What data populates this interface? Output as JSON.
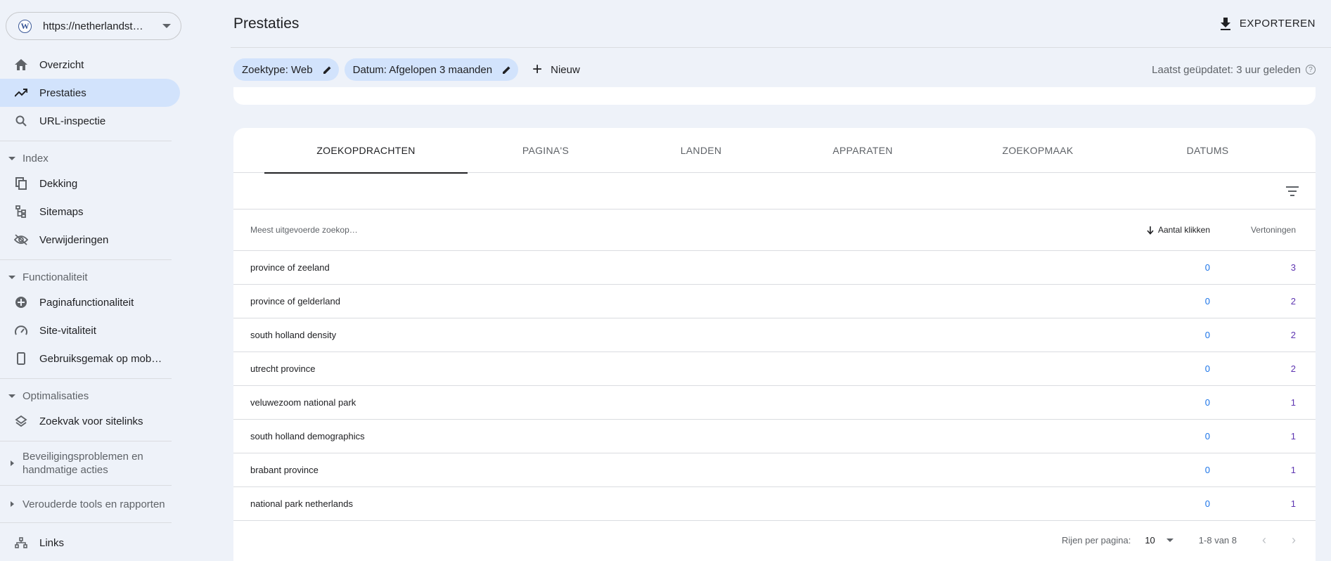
{
  "property": {
    "url": "https://netherlandst…"
  },
  "nav": {
    "overzicht": "Overzicht",
    "prestaties": "Prestaties",
    "url_inspectie": "URL-inspectie",
    "index_section": "Index",
    "dekking": "Dekking",
    "sitemaps": "Sitemaps",
    "verwijderingen": "Verwijderingen",
    "functionaliteit_section": "Functionaliteit",
    "paginafunctionaliteit": "Paginafunctionaliteit",
    "site_vitaliteit": "Site-vitaliteit",
    "gebruiksgemak": "Gebruiksgemak op mob…",
    "optimalisaties_section": "Optimalisaties",
    "zoekvak": "Zoekvak voor sitelinks",
    "beveiliging_section_1": "Beveiligingsproblemen en",
    "beveiliging_section_2": "handmatige acties",
    "verouderde_section": "Verouderde tools en rapporten",
    "links": "Links"
  },
  "header": {
    "title": "Prestaties",
    "export_label": "EXPORTEREN"
  },
  "filters": {
    "search_type": "Zoektype: Web",
    "date": "Datum: Afgelopen 3 maanden",
    "new_label": "Nieuw",
    "last_updated": "Laatst geüpdatet: 3 uur geleden"
  },
  "tabs": [
    "ZOEKOPDRACHTEN",
    "PAGINA'S",
    "LANDEN",
    "APPARATEN",
    "ZOEKOPMAAK",
    "DATUMS"
  ],
  "table": {
    "col_query": "Meest uitgevoerde zoekop…",
    "col_clicks": "Aantal klikken",
    "col_impressions": "Vertoningen",
    "rows": [
      {
        "query": "province of zeeland",
        "clicks": "0",
        "impressions": "3"
      },
      {
        "query": "province of gelderland",
        "clicks": "0",
        "impressions": "2"
      },
      {
        "query": "south holland density",
        "clicks": "0",
        "impressions": "2"
      },
      {
        "query": "utrecht province",
        "clicks": "0",
        "impressions": "2"
      },
      {
        "query": "veluwezoom national park",
        "clicks": "0",
        "impressions": "1"
      },
      {
        "query": "south holland demographics",
        "clicks": "0",
        "impressions": "1"
      },
      {
        "query": "brabant province",
        "clicks": "0",
        "impressions": "1"
      },
      {
        "query": "national park netherlands",
        "clicks": "0",
        "impressions": "1"
      }
    ]
  },
  "pager": {
    "rows_label": "Rijen per pagina:",
    "rows_value": "10",
    "range": "1-8 van 8"
  },
  "colors": {
    "active_bg": "#d2e3fc",
    "clicks": "#1a73e8",
    "impressions": "#5e35b1"
  }
}
